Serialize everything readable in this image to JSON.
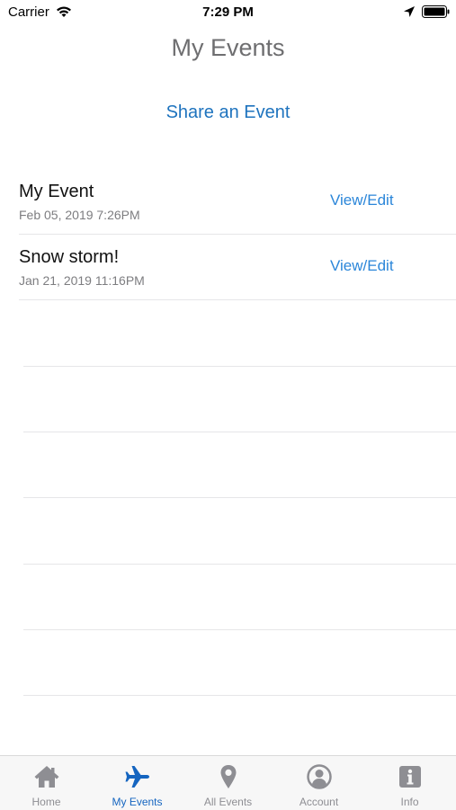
{
  "status_bar": {
    "carrier": "Carrier",
    "time": "7:29 PM"
  },
  "header": {
    "title": "My Events"
  },
  "actions": {
    "share_label": "Share an Event"
  },
  "events": [
    {
      "name": "My Event",
      "date": "Feb 05, 2019 7:26PM",
      "action_label": "View/Edit"
    },
    {
      "name": "Snow storm!",
      "date": "Jan 21, 2019 11:16PM",
      "action_label": "View/Edit"
    }
  ],
  "tab_bar": {
    "tabs": [
      {
        "label": "Home",
        "icon": "home-icon",
        "active": false
      },
      {
        "label": "My Events",
        "icon": "airplane-icon",
        "active": true
      },
      {
        "label": "All Events",
        "icon": "map-pin-icon",
        "active": false
      },
      {
        "label": "Account",
        "icon": "user-circle-icon",
        "active": false
      },
      {
        "label": "Info",
        "icon": "info-icon",
        "active": false
      }
    ]
  },
  "colors": {
    "accent": "#1e73be",
    "link": "#2b86d9",
    "tab_active": "#1565c0",
    "tab_inactive": "#8e8e93"
  }
}
